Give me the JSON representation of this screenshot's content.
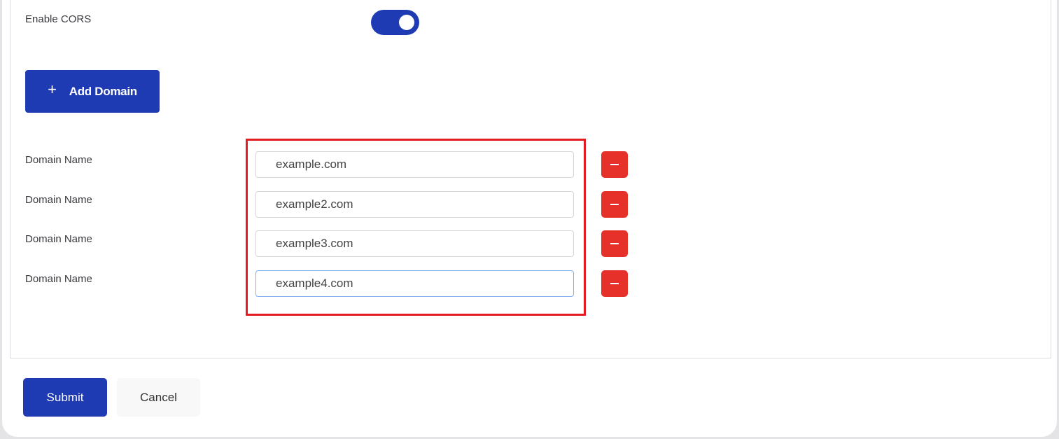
{
  "cors": {
    "label": "Enable CORS",
    "enabled": true
  },
  "add_domain": {
    "icon": "plus-icon",
    "plus": "+",
    "label": "Add Domain"
  },
  "domains": [
    {
      "label": "Domain Name",
      "value": "example.com"
    },
    {
      "label": "Domain Name",
      "value": "example2.com"
    },
    {
      "label": "Domain Name",
      "value": "example3.com"
    },
    {
      "label": "Domain Name",
      "value": "example4.com"
    }
  ],
  "actions": {
    "submit": "Submit",
    "cancel": "Cancel"
  },
  "colors": {
    "primary": "#1f3bb3",
    "danger": "#e5312a",
    "highlight": "#e31c24"
  }
}
